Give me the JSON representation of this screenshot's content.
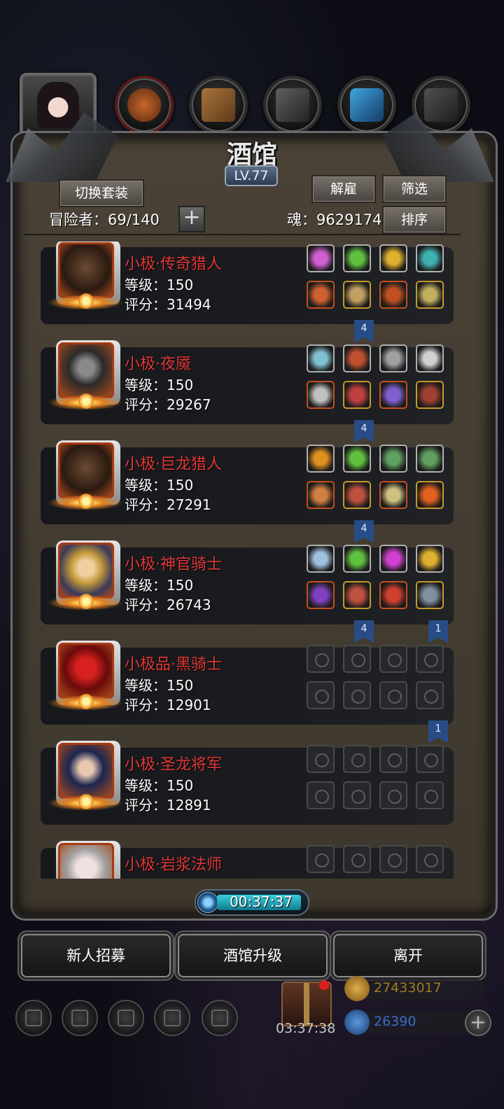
{
  "header": {
    "title": "酒馆",
    "level": "LV.77"
  },
  "toolbar": {
    "switch_outfit_label": "切换套装",
    "dismiss_label": "解雇",
    "filter_label": "筛选",
    "sort_label": "排序",
    "adventurer_count": "冒险者：69/140",
    "soul_value": "魂：9629174",
    "add_slot_symbol": "+"
  },
  "heroes": [
    {
      "name": "小极·传奇猎人",
      "level": "等级：150",
      "score": "评分：31494",
      "portrait": "hunter",
      "gear": [
        "#d060d0",
        "#60c040",
        "#e0b030",
        "#40b0b0",
        "#d06030",
        "#c0a060",
        "#c05020",
        "#c0b060"
      ],
      "badges": [
        "4"
      ]
    },
    {
      "name": "小极·夜魇",
      "level": "等级：150",
      "score": "评分：29267",
      "portrait": "knight",
      "gear": [
        "#80c0d0",
        "#c05030",
        "#a0a0a0",
        "#d0d0d0",
        "#c0c0c0",
        "#c04040",
        "#8060d0",
        "#a04030"
      ],
      "badges": [
        "4"
      ]
    },
    {
      "name": "小极·巨龙猎人",
      "level": "等级：150",
      "score": "评分：27291",
      "portrait": "hunter",
      "gear": [
        "#e09020",
        "#60c040",
        "#60a060",
        "#60a060",
        "#d08040",
        "#c05040",
        "#d0c080",
        "#e06020"
      ],
      "badges": [
        "4"
      ]
    },
    {
      "name": "小极·神官骑士",
      "level": "等级：150",
      "score": "评分：26743",
      "portrait": "priest",
      "gear": [
        "#a0c0e0",
        "#60c040",
        "#d040d0",
        "#e0b030",
        "#8040c0",
        "#c05040",
        "#d04030",
        "#8090a0"
      ],
      "badges": [
        "4",
        "1"
      ]
    },
    {
      "name": "小极品·黑骑士",
      "level": "等级：150",
      "score": "评分：12901",
      "portrait": "black",
      "gear": [],
      "badges": [
        "1"
      ]
    },
    {
      "name": "小极·圣龙将军",
      "level": "等级：150",
      "score": "评分：12891",
      "portrait": "dragon",
      "gear": [],
      "badges": []
    },
    {
      "name": "小极·岩浆法师",
      "level": "",
      "score": "",
      "portrait": "mage",
      "gear": [],
      "badges": []
    }
  ],
  "timer": {
    "value": "00:37:37"
  },
  "actions": {
    "recruit_label": "新人招募",
    "upgrade_label": "酒馆升级",
    "leave_label": "离开"
  },
  "bottom": {
    "gift_timer": "03:37:38",
    "gold": "27433017",
    "gems": "26390",
    "add_symbol": "+"
  },
  "colors": {
    "hero_name": "#e03838",
    "badge": "#284c86",
    "gold_text": "#a07c20",
    "gem_text": "#3a6cc8"
  }
}
